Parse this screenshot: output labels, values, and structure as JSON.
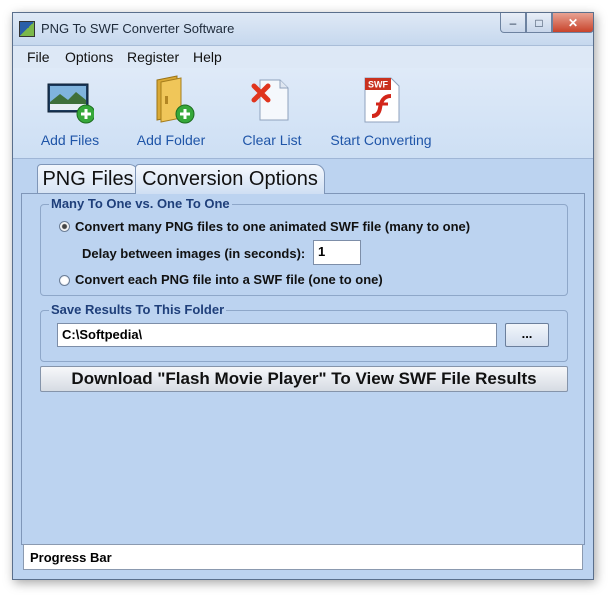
{
  "window": {
    "title": "PNG To SWF Converter Software"
  },
  "title_buttons": {
    "minimize": "–",
    "maximize": "□",
    "close": "✕"
  },
  "menu": [
    "File",
    "Options",
    "Register",
    "Help"
  ],
  "toolbar": {
    "add_files": "Add Files",
    "add_folder": "Add Folder",
    "clear_list": "Clear List",
    "start_converting": "Start Converting",
    "swf_badge": "SWF"
  },
  "tabs": [
    "PNG Files",
    "Conversion Options"
  ],
  "many_to_one": {
    "legend": "Many To One vs. One To One",
    "option_many": "Convert many PNG files to one animated SWF file (many to one)",
    "delay_label": "Delay between images (in seconds):",
    "delay_value": "1",
    "option_one": "Convert each PNG file into a SWF file (one to one)",
    "selected": "many"
  },
  "save_folder": {
    "legend": "Save Results To This Folder",
    "path": "C:\\Softpedia\\",
    "browse_label": "..."
  },
  "download_button": "Download \"Flash Movie Player\" To View SWF File Results",
  "status": {
    "progress_label": "Progress Bar"
  },
  "colors": {
    "accent": "#1f55a8",
    "window_bg": "#bcd3f0",
    "legend": "#1f3f7a"
  }
}
